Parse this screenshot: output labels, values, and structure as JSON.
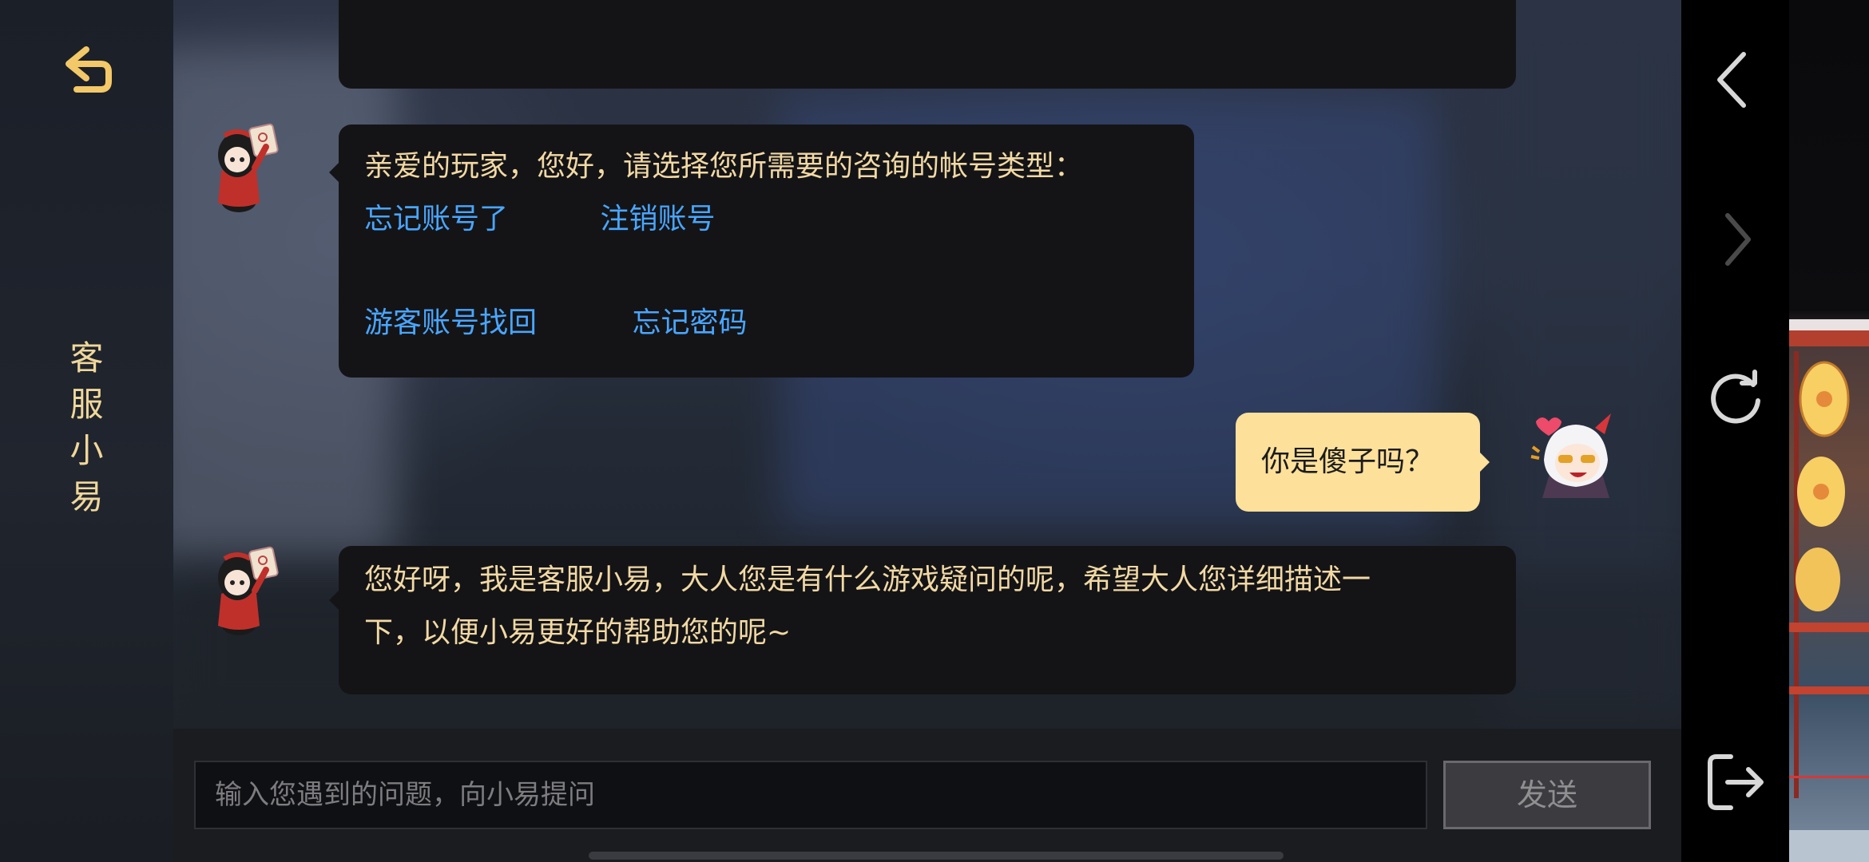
{
  "sidebar": {
    "title_chars": [
      "客",
      "服",
      "小",
      "易"
    ]
  },
  "chat": {
    "messages": [
      {
        "from": "agent",
        "text": "亲爱的玩家，您好，请选择您所需要的咨询的帐号类型：",
        "options": [
          "忘记账号了",
          "注销账号",
          "游客账号找回",
          "忘记密码"
        ]
      },
      {
        "from": "user",
        "text": "你是傻子吗？"
      },
      {
        "from": "agent",
        "text_line1": "您好呀，我是客服小易，大人您是有什么游戏疑问的呢，希望大人您详细描述一",
        "text_line2": "下，以便小易更好的帮助您的呢~"
      }
    ]
  },
  "input": {
    "placeholder": "输入您遇到的问题，向小易提问",
    "send_label": "发送"
  },
  "colors": {
    "accent_gold": "#f2d9a4",
    "link_blue": "#49a6ff",
    "user_bubble": "#fde09a",
    "agent_bubble": "#141417"
  },
  "icons": [
    "back-arrow-icon",
    "chevron-left-icon",
    "chevron-right-icon",
    "refresh-icon",
    "exit-icon"
  ]
}
